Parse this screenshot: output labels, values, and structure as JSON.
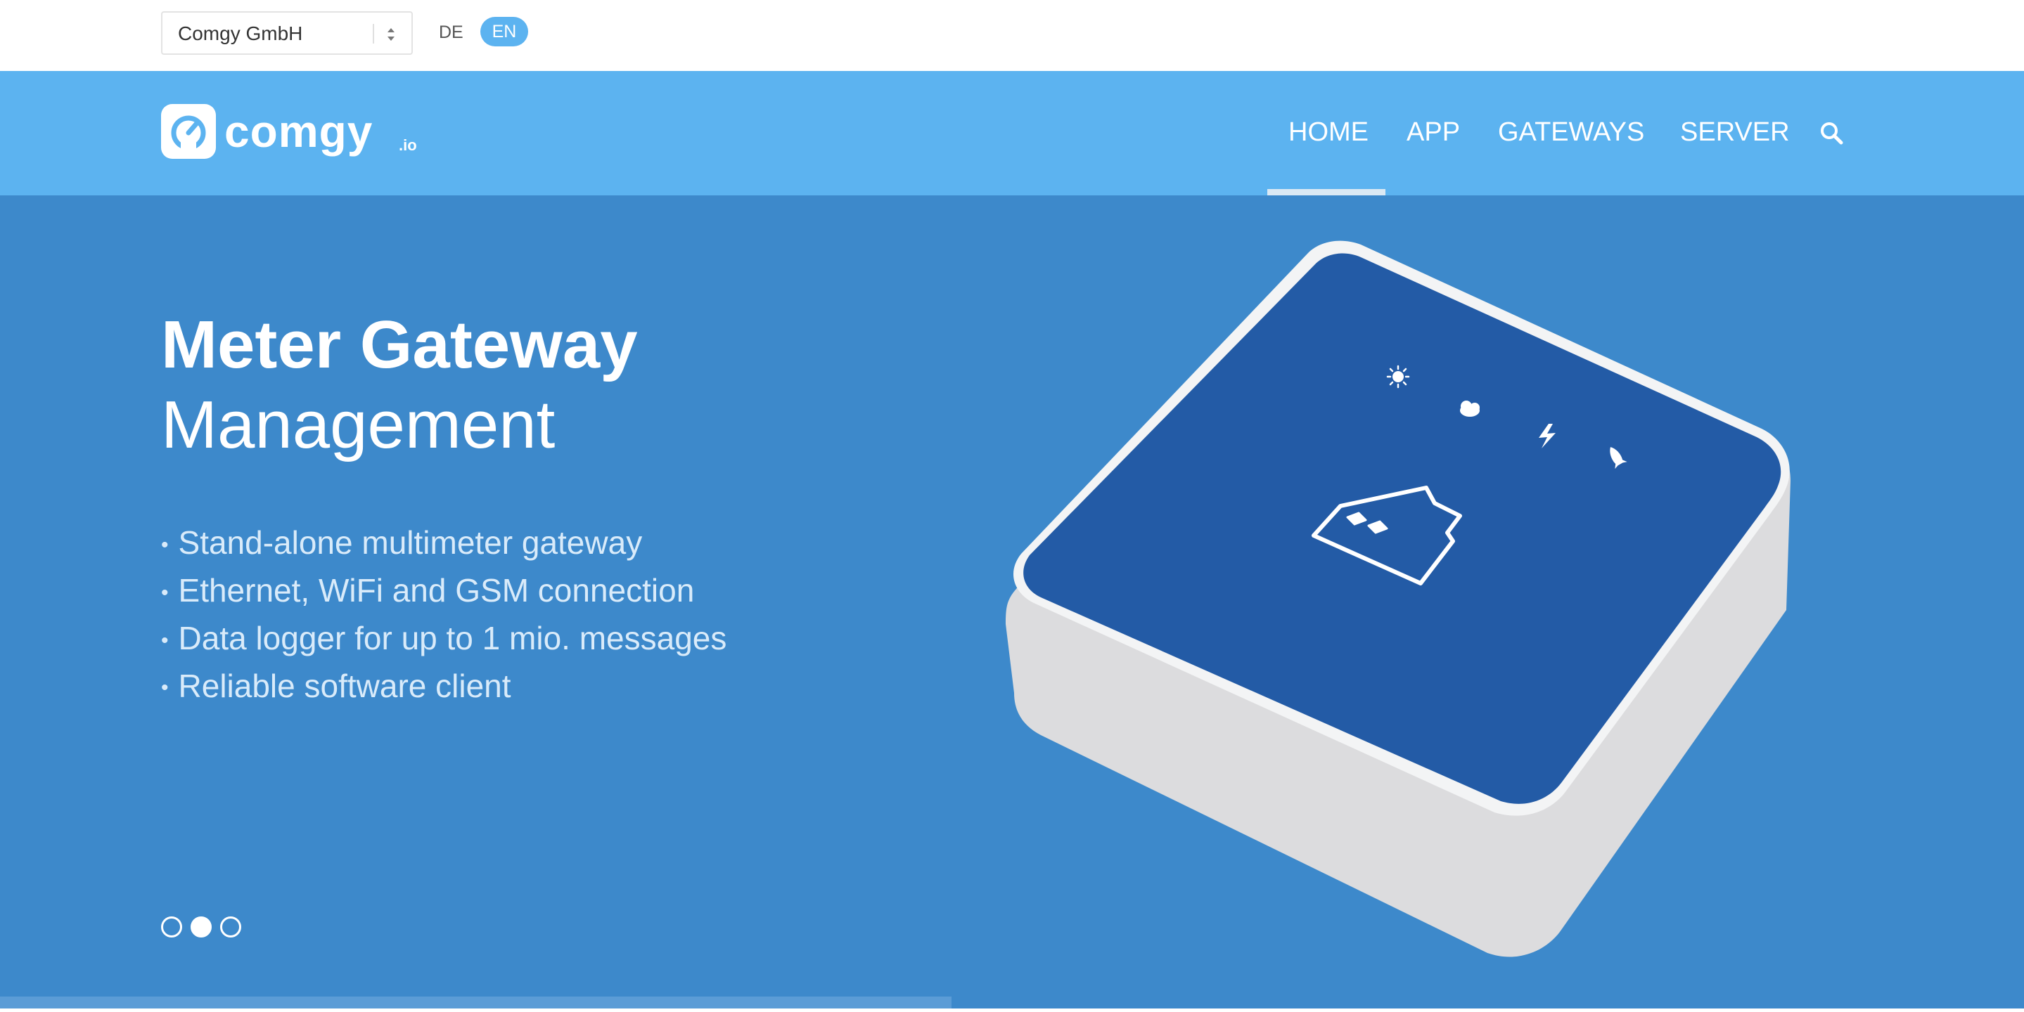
{
  "topbar": {
    "company_select": {
      "value": "Comgy GmbH",
      "icon": "select-arrows-icon"
    },
    "languages": [
      {
        "code": "DE",
        "active": false
      },
      {
        "code": "EN",
        "active": true
      }
    ]
  },
  "header": {
    "logo": {
      "word": "comgy",
      "tld": ".io",
      "icon": "speedometer-icon"
    },
    "nav": [
      {
        "label": "HOME",
        "active": true
      },
      {
        "label": "APP",
        "active": false
      },
      {
        "label": "GATEWAYS",
        "active": false
      },
      {
        "label": "SERVER",
        "active": false
      }
    ],
    "search_icon": "search-icon"
  },
  "hero": {
    "title_bold": "Meter Gateway",
    "title_light": "Management",
    "bullet": "•",
    "features": [
      "Stand-alone multimeter gateway",
      "Ethernet, WiFi and GSM connection",
      "Data logger for up to 1 mio. messages",
      "Reliable software client"
    ],
    "slider": {
      "slides": 3,
      "active_index": 1,
      "progress": 0.47
    },
    "device_icons": [
      "sun-icon",
      "cloud-icon",
      "lightning-icon",
      "rocket-icon",
      "house-icon"
    ]
  },
  "colors": {
    "nav_bg": "#5cb3f0",
    "hero_bg": "#3d89cb",
    "device_top": "#235ba6",
    "device_body": "#f2f2f2",
    "lang_active": "#5cb3f0"
  }
}
